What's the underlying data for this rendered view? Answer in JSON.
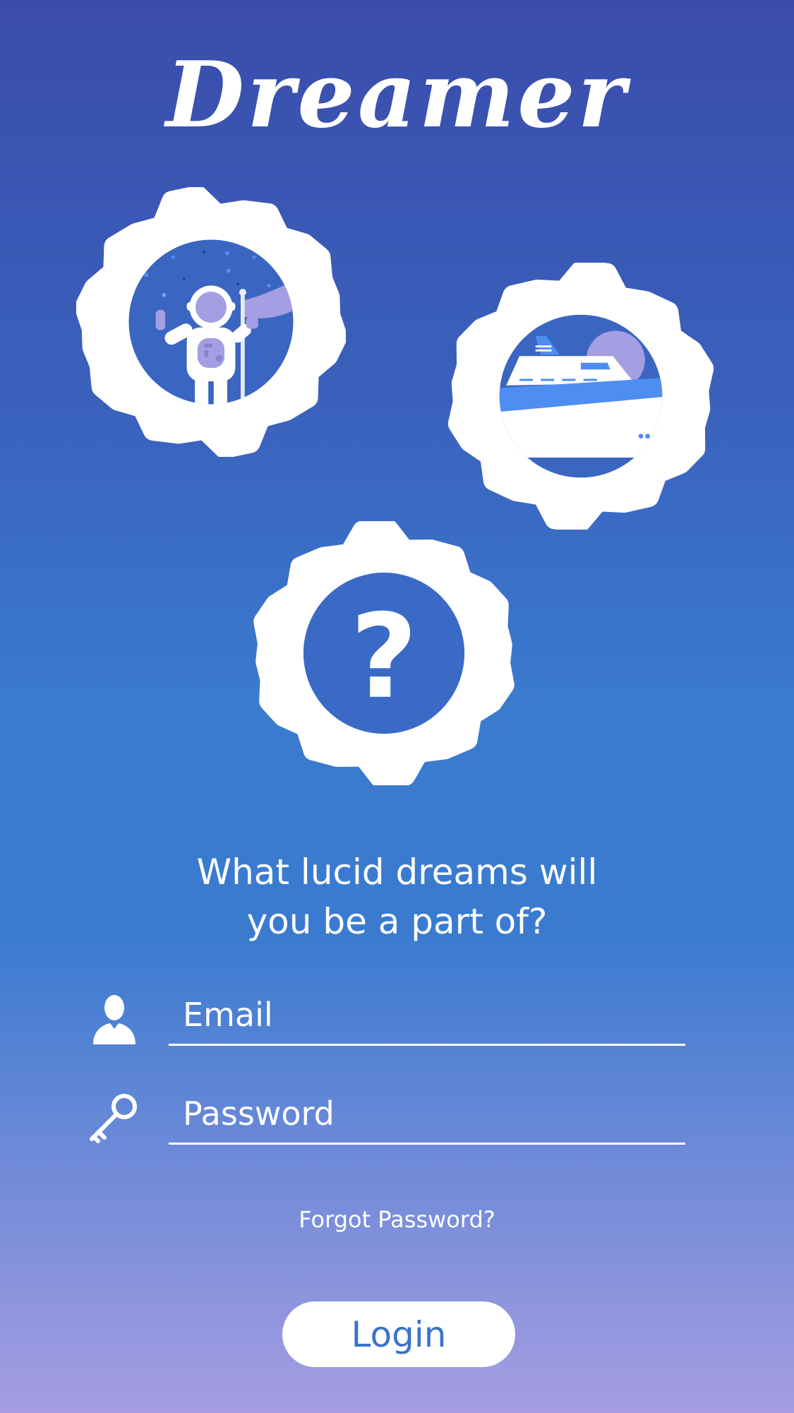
{
  "app": {
    "logo_text": "Dreamer"
  },
  "badges": [
    {
      "name": "astronaut-badge",
      "icon": "astronaut-with-flag-illustration"
    },
    {
      "name": "ship-badge",
      "icon": "cruise-ship-illustration"
    },
    {
      "name": "mystery-badge",
      "icon": "question-mark-icon",
      "symbol": "?"
    }
  ],
  "tagline": {
    "line1": "What lucid dreams will",
    "line2": "you be a part of?"
  },
  "form": {
    "email_placeholder": "Email",
    "email_icon": "user-icon",
    "password_placeholder": "Password",
    "password_icon": "key-icon",
    "forgot_label": "Forgot Password?",
    "login_label": "Login"
  },
  "colors": {
    "gradient_top": "#3a4cab",
    "gradient_mid": "#3a7bd0",
    "gradient_bottom": "#a69de2",
    "badge_fill": "#3a66c2",
    "accent_purple": "#a59ee3",
    "accent_blue": "#4e8ef2",
    "login_text": "#3a73c9"
  }
}
